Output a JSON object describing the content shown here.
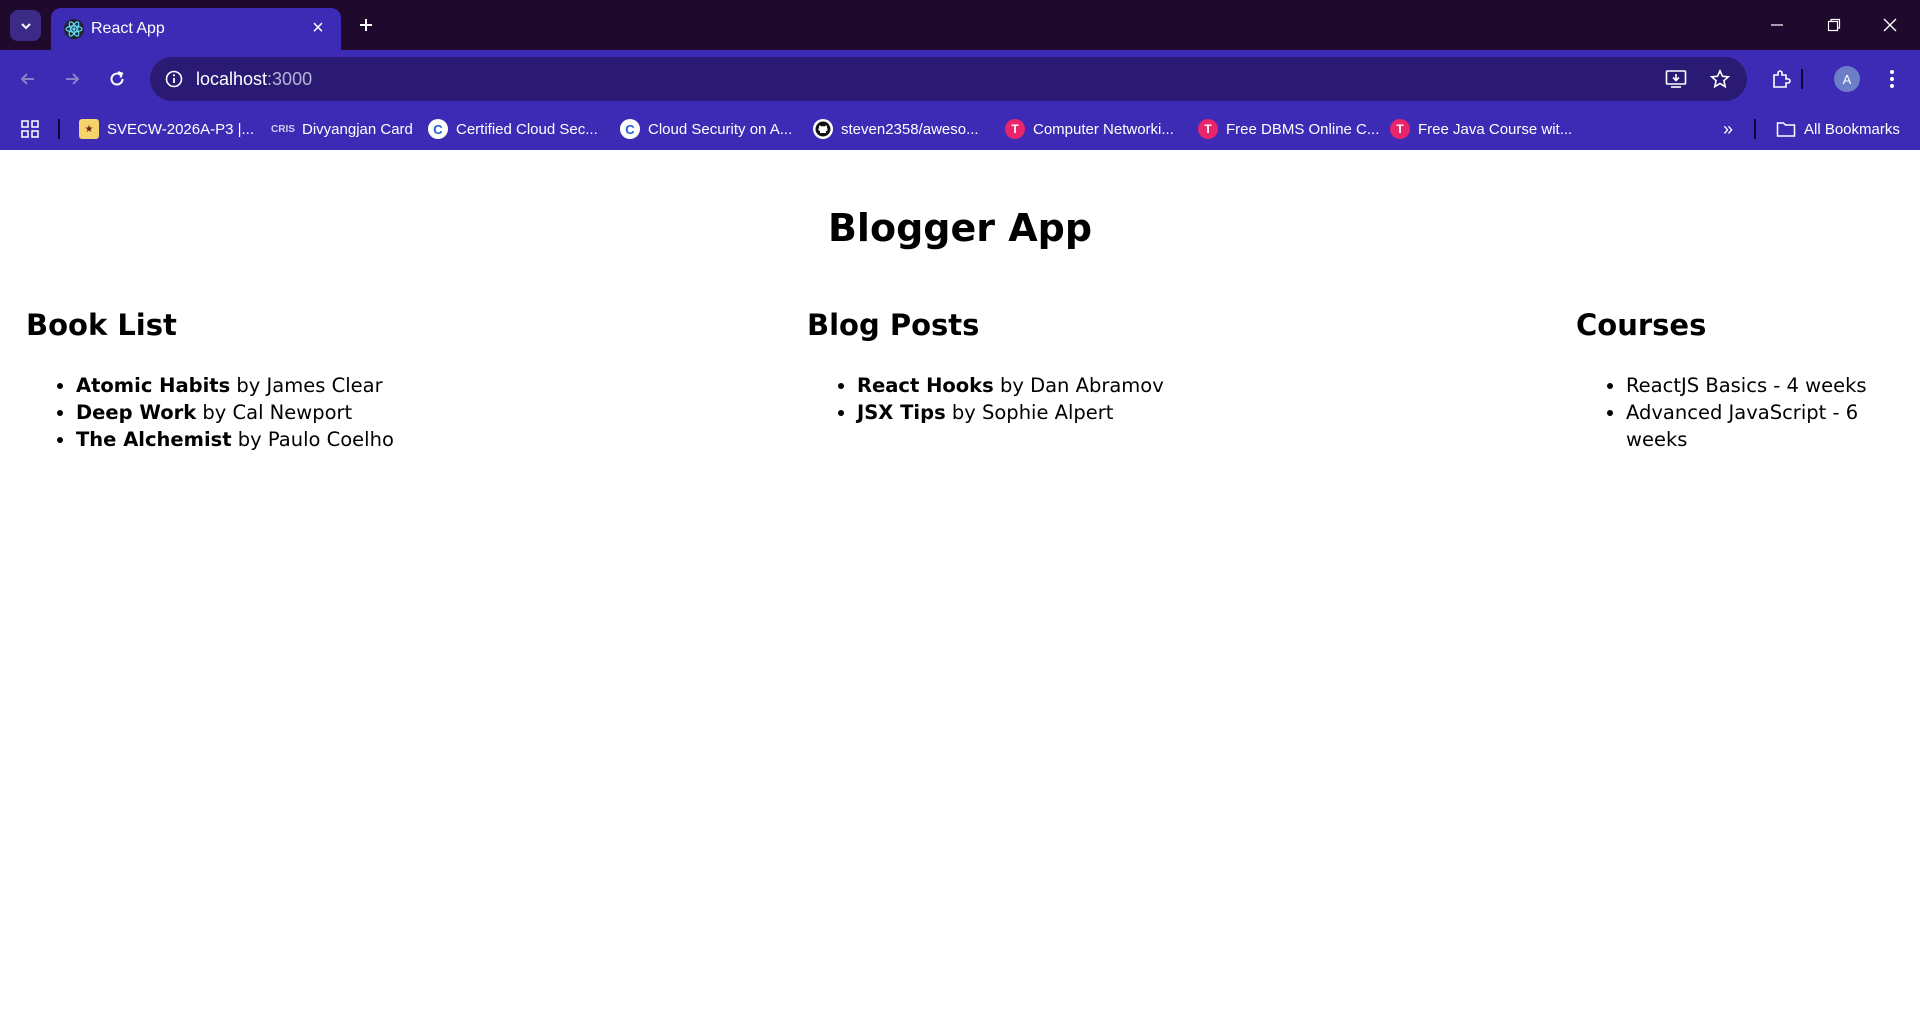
{
  "browser": {
    "tab": {
      "title": "React App"
    },
    "address_bar": {
      "host": "localhost",
      "port": ":3000"
    },
    "profile_initial": "A",
    "bookmarks": [
      {
        "label": "SVECW-2026A-P3 |...",
        "icon": "svecw-logo-icon"
      },
      {
        "label": "Divyangjan Card",
        "icon": "cris-logo-icon",
        "icon_text": "CRIS"
      },
      {
        "label": "Certified Cloud Sec...",
        "icon": "c-logo-icon",
        "icon_text": "C"
      },
      {
        "label": "Cloud Security on A...",
        "icon": "c-logo-icon",
        "icon_text": "C"
      },
      {
        "label": "steven2358/aweso...",
        "icon": "github-icon"
      },
      {
        "label": "Computer Networki...",
        "icon": "t-logo-icon"
      },
      {
        "label": "Free DBMS Online C...",
        "icon": "t-logo-icon"
      },
      {
        "label": "Free Java Course wit...",
        "icon": "t-logo-icon"
      }
    ],
    "all_bookmarks_label": "All Bookmarks",
    "colors": {
      "tabstrip": "#1f0a2e",
      "toolbar": "#3d2ab5",
      "omnibox": "#2a1a74"
    }
  },
  "app": {
    "title": "Blogger App",
    "books": {
      "heading": "Book List",
      "items": [
        {
          "title": "Atomic Habits",
          "author_text": " by James Clear"
        },
        {
          "title": "Deep Work",
          "author_text": " by Cal Newport"
        },
        {
          "title": "The Alchemist",
          "author_text": " by Paulo Coelho"
        }
      ]
    },
    "blogs": {
      "heading": "Blog Posts",
      "items": [
        {
          "title": "React Hooks",
          "author_text": " by Dan Abramov"
        },
        {
          "title": "JSX Tips",
          "author_text": " by Sophie Alpert"
        }
      ]
    },
    "courses": {
      "heading": "Courses",
      "items": [
        {
          "text": "ReactJS Basics - 4 weeks"
        },
        {
          "text": "Advanced JavaScript - 6 weeks"
        }
      ]
    }
  }
}
